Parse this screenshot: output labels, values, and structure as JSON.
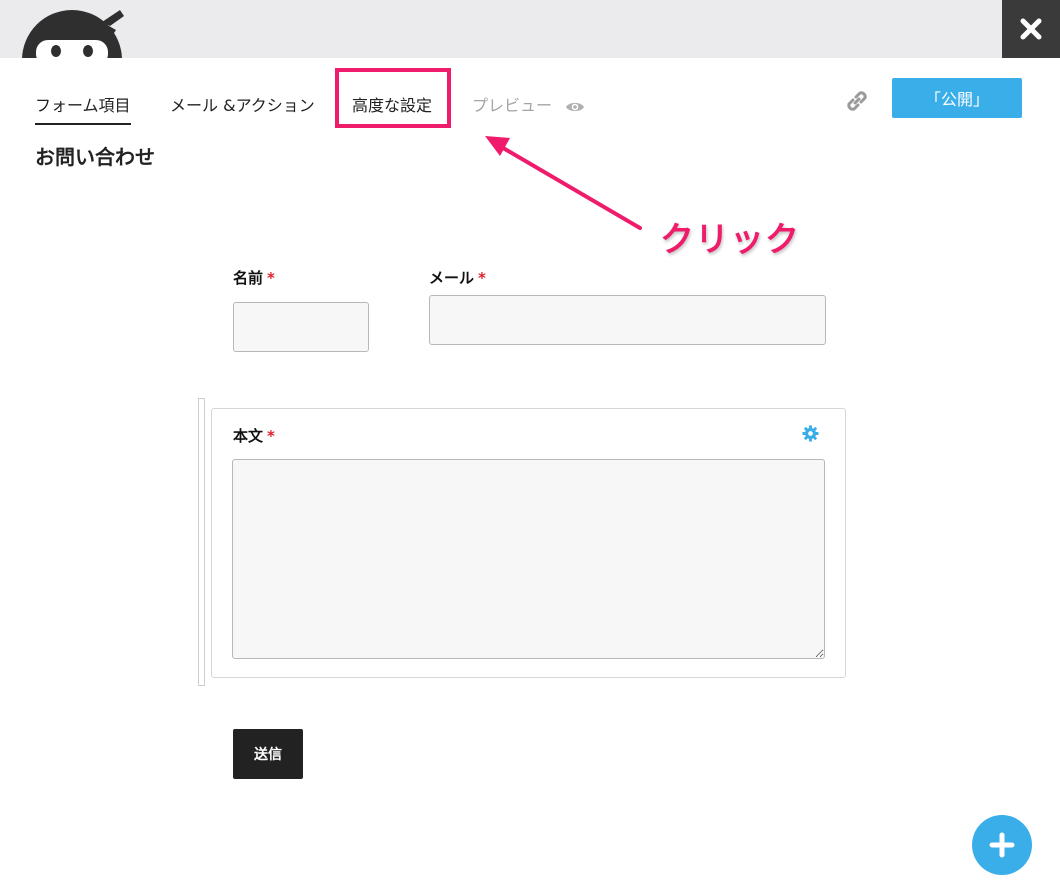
{
  "header": {
    "logo_icon": "ninja-logo-icon",
    "close_icon": "close-icon"
  },
  "tabs": [
    {
      "label": "フォーム項目",
      "active": true
    },
    {
      "label": "メール &アクション",
      "active": false
    },
    {
      "label": "高度な設定",
      "active": false
    },
    {
      "label": "プレビュー",
      "active": false,
      "icon": "eye-icon"
    }
  ],
  "toolbar": {
    "link_icon": "link-icon",
    "publish_label": "「公開」"
  },
  "form": {
    "title": "お問い合わせ",
    "fields": [
      {
        "label": "名前",
        "required_mark": "*",
        "value": ""
      },
      {
        "label": "メール",
        "required_mark": "*",
        "value": ""
      },
      {
        "label": "本文",
        "required_mark": "*",
        "value": ""
      }
    ],
    "submit_label": "送信"
  },
  "annotation": {
    "text": "クリック",
    "color": "#ee1c6a"
  },
  "colors": {
    "accent": "#3aaee9",
    "highlight": "#ee1c6a",
    "dark": "#222222"
  },
  "fab_icon": "plus-icon"
}
